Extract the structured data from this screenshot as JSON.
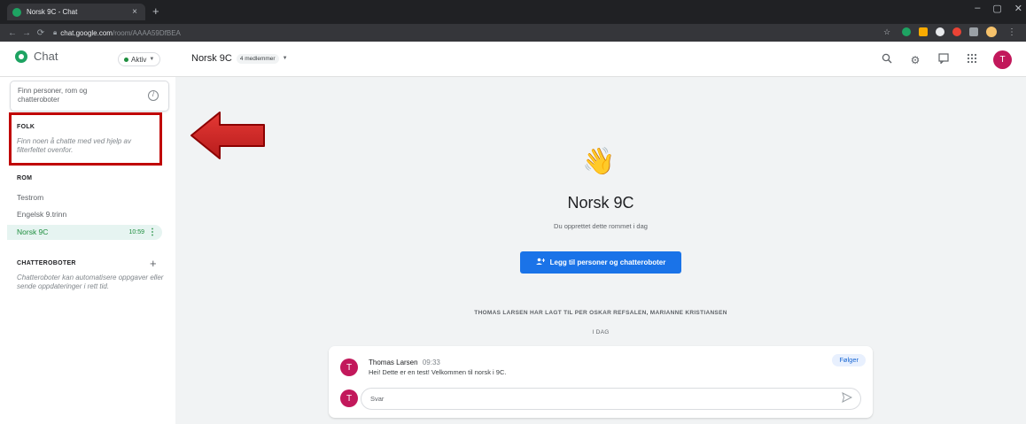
{
  "browser": {
    "tab_title": "Norsk 9C - Chat",
    "tab_close": "×",
    "new_tab": "+",
    "url_host": "chat.google.com",
    "url_path": "/room/AAAA59DfBEA",
    "window_controls": [
      "–",
      "▢",
      "✕"
    ],
    "extension_colors": [
      "#1ea362",
      "#f9ab00",
      "#e8eaed",
      "#ea4335",
      "#9aa0a6"
    ]
  },
  "header": {
    "app_name": "Chat",
    "status": "Aktiv",
    "room_name": "Norsk 9C",
    "members": "4 medlemmer",
    "user_initial": "T"
  },
  "sidebar": {
    "search_placeholder": "Finn personer, rom og chatteroboter",
    "search_shortcut": "/",
    "folk": {
      "title": "FOLK",
      "hint": "Finn noen å chatte med ved hjelp av filterfeltet ovenfor."
    },
    "rom": {
      "title": "ROM",
      "items": [
        {
          "label": "Testrom"
        },
        {
          "label": "Engelsk 9.trinn"
        },
        {
          "label": "Norsk 9C",
          "time": "10:59",
          "active": true
        }
      ]
    },
    "bots": {
      "title": "CHATTEROBOTER",
      "add": "+",
      "hint": "Chatteroboter kan automatisere oppgaver eller sende oppdateringer i rett tid."
    }
  },
  "main": {
    "welcome_emoji": "👋",
    "room_title": "Norsk 9C",
    "created_text": "Du opprettet dette rommet i dag",
    "add_button": "Legg til personer og chatteroboter",
    "system_message": "THOMAS LARSEN HAR LAGT TIL PER OSKAR REFSALEN, MARIANNE KRISTIANSEN",
    "date_divider": "I DAG",
    "message": {
      "avatar_initial": "T",
      "sender": "Thomas Larsen",
      "time": "09:33",
      "text": "Hei! Dette er en test! Velkommen til norsk i 9C.",
      "follow": "Følger"
    },
    "reply_placeholder": "Svar"
  },
  "colors": {
    "accent_green": "#1e8e3e",
    "button_blue": "#1a73e8",
    "avatar_red": "#c2185b",
    "highlight_red": "#c00000"
  }
}
